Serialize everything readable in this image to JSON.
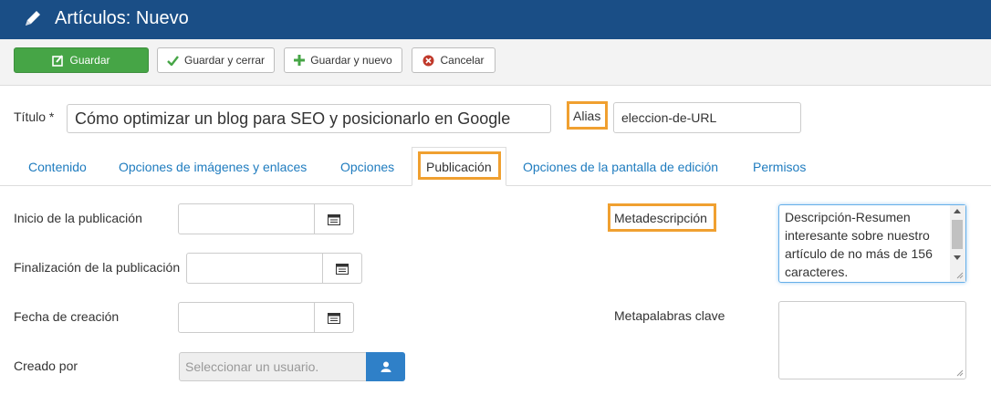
{
  "header": {
    "title": "Artículos: Nuevo",
    "icon": "pencil-icon"
  },
  "toolbar": {
    "save_label": "Guardar",
    "save_close_label": "Guardar y cerrar",
    "save_new_label": "Guardar y nuevo",
    "cancel_label": "Cancelar"
  },
  "form": {
    "title_label": "Título *",
    "title_value": "Cómo optimizar un blog para SEO y posicionarlo en Google",
    "alias_label": "Alias",
    "alias_value": "eleccion-de-URL"
  },
  "tabs": [
    {
      "label": "Contenido"
    },
    {
      "label": "Opciones de imágenes y enlaces"
    },
    {
      "label": "Opciones"
    },
    {
      "label": "Publicación",
      "active": true
    },
    {
      "label": "Opciones de la pantalla de edición"
    },
    {
      "label": "Permisos"
    }
  ],
  "publishing": {
    "start_label": "Inicio de la publicación",
    "finish_label": "Finalización de la publicación",
    "created_label": "Fecha de creación",
    "created_by_label": "Creado por",
    "user_placeholder": "Seleccionar un usuario."
  },
  "metadata": {
    "desc_label": "Metadescripción",
    "desc_value": "Descripción-Resumen interesante sobre nuestro artículo de no más de 156 caracteres.",
    "keywords_label": "Metapalabras clave"
  },
  "colors": {
    "header_bg": "#1a4e86",
    "save_green": "#46a546",
    "highlight_orange": "#f0a030",
    "link_blue": "#1f7cbf",
    "user_btn_blue": "#2f80c8"
  }
}
